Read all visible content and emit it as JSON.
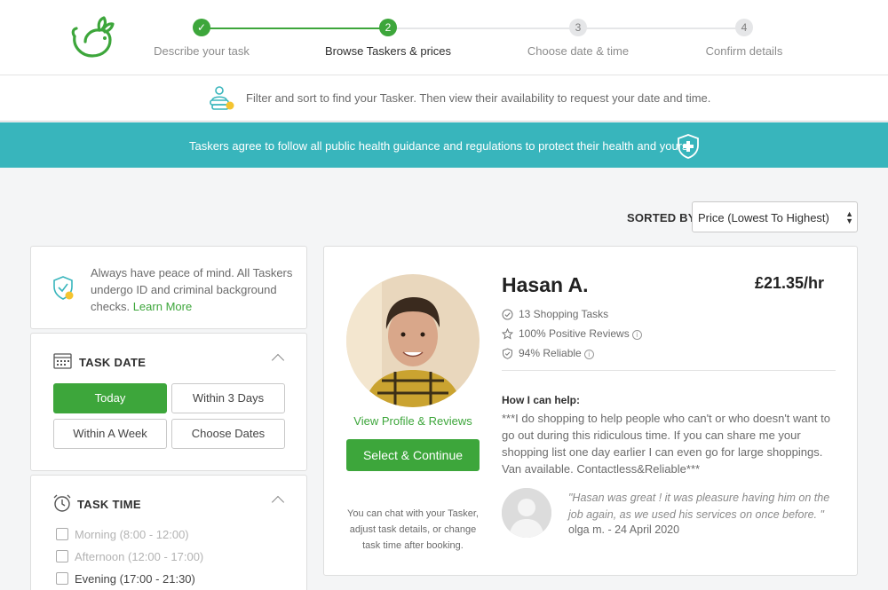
{
  "colors": {
    "brand_green": "#3da63b",
    "banner_teal": "#38b5bc"
  },
  "header": {
    "logo": "taskrabbit-logo",
    "steps": [
      {
        "number": "✓",
        "label": "Describe your task",
        "state": "done"
      },
      {
        "number": "2",
        "label": "Browse Taskers & prices",
        "state": "active"
      },
      {
        "number": "3",
        "label": "Choose date & time",
        "state": "todo"
      },
      {
        "number": "4",
        "label": "Confirm details",
        "state": "todo"
      }
    ]
  },
  "infobar": {
    "icon": "taskers-icon",
    "text": "Filter and sort to find your Tasker. Then view their availability to request your date and time."
  },
  "banner": {
    "icon": "shield-plus-icon",
    "text": "Taskers agree to follow all public health guidance and regulations to protect their health and yours."
  },
  "sort": {
    "label": "SORTED BY:",
    "value": "Price (Lowest To Highest)"
  },
  "peace": {
    "icon": "shield-check-icon",
    "text": "Always have peace of mind. All Taskers undergo ID and criminal background checks.",
    "link": "Learn More"
  },
  "task_date": {
    "title": "TASK DATE",
    "icon": "calendar-icon",
    "options": [
      {
        "label": "Today",
        "selected": true
      },
      {
        "label": "Within 3 Days",
        "selected": false
      },
      {
        "label": "Within A Week",
        "selected": false
      },
      {
        "label": "Choose Dates",
        "selected": false
      }
    ]
  },
  "task_time": {
    "title": "TASK TIME",
    "icon": "alarm-clock-icon",
    "options": [
      {
        "label": "Morning (8:00 - 12:00)",
        "enabled": false
      },
      {
        "label": "Afternoon (12:00 - 17:00)",
        "enabled": false
      },
      {
        "label": "Evening (17:00 - 21:30)",
        "enabled": true
      }
    ]
  },
  "tasker": {
    "name": "Hasan A.",
    "rate": "£21.35/hr",
    "stats": [
      {
        "icon": "check-circle-icon",
        "text": "13 Shopping Tasks"
      },
      {
        "icon": "star-icon",
        "text": "100% Positive Reviews"
      },
      {
        "icon": "shield-icon",
        "text": "94% Reliable"
      }
    ],
    "view_profile": "View Profile & Reviews",
    "select_button": "Select & Continue",
    "chat_note": "You can chat with your Tasker, adjust task details, or change task time after booking.",
    "help_title": "How I can help:",
    "help_text": "***I do shopping to help people who can't or who doesn't want to go out during this ridiculous time. If you can share me your shopping list one day earlier I can even go for large shoppings. Van available. Contactless&Reliable***",
    "review": {
      "quote": "\"Hasan was great ! it was pleasure having him on the job again, as we used his services on once before. \"",
      "author": "olga m. - 24 April 2020"
    }
  }
}
